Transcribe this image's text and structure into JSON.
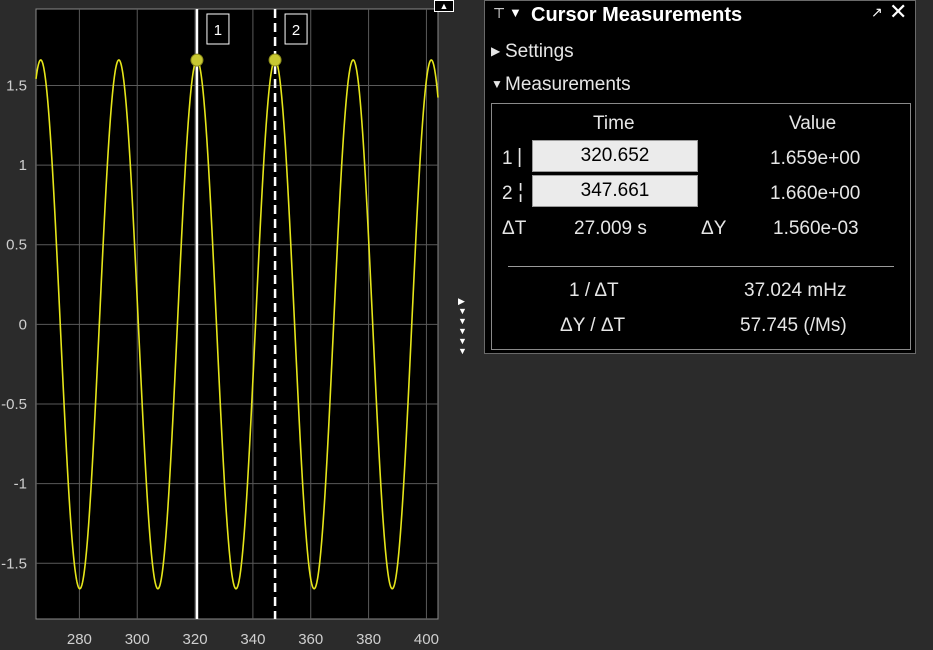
{
  "plot": {
    "x_ticks": [
      "280",
      "300",
      "320",
      "340",
      "360",
      "380",
      "400"
    ],
    "y_ticks": [
      "1.5",
      "1",
      "0.5",
      "0",
      "-0.5",
      "-1",
      "-1.5"
    ],
    "toggle_icon": "expand-toolbar-icon",
    "cursor1_label": "1",
    "cursor2_label": "2",
    "colors": {
      "background": "#000000",
      "trace": "#e6e61a",
      "grid": "#5a5a5a",
      "cursor": "#ffffff",
      "marker": "#c8c832"
    }
  },
  "panel": {
    "pin_icon": "pin-icon",
    "title": "Cursor Measurements",
    "undock_icon": "undock-arrow-icon",
    "close_icon": "close-icon",
    "settings_label": "Settings",
    "measurements_label": "Measurements",
    "table": {
      "time_header": "Time",
      "value_header": "Value",
      "row1_label": "1",
      "row1_time": "320.652",
      "row1_value": "1.659e+00",
      "row2_label": "2",
      "row2_time": "347.661",
      "row2_value": "1.660e+00",
      "delta_t_label": "ΔT",
      "delta_t_value": "27.009 s",
      "delta_y_label": "ΔY",
      "delta_y_value": "1.560e-03",
      "inv_dt_label": "1 / ΔT",
      "inv_dt_value": "37.024 mHz",
      "dy_dt_label": "ΔY / ΔT",
      "dy_dt_value": "57.745 (/Ms)"
    }
  },
  "chart_data": {
    "type": "line",
    "title": "",
    "xlabel": "",
    "ylabel": "",
    "xlim": [
      265,
      404
    ],
    "ylim": [
      -1.85,
      1.98
    ],
    "grid": true,
    "series": [
      {
        "function": "sine",
        "amplitude": 1.66,
        "period_s": 27.009,
        "peak_at_x": 320.652,
        "x_start": 265,
        "x_end": 404
      }
    ],
    "cursors": [
      {
        "x": 320.652,
        "y": 1.659,
        "style": "solid"
      },
      {
        "x": 347.661,
        "y": 1.66,
        "style": "dashed"
      }
    ]
  }
}
